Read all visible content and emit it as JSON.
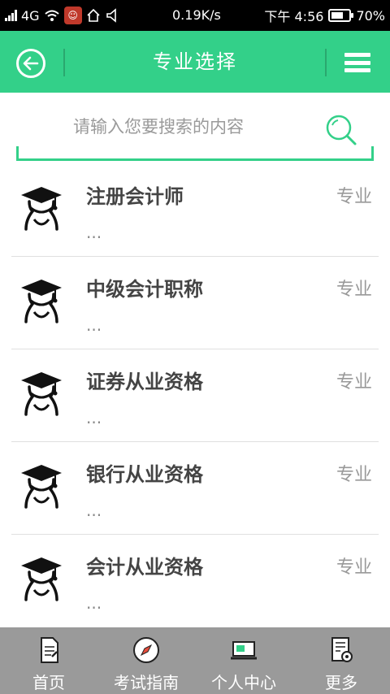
{
  "status_bar": {
    "network": "4G",
    "speed": "0.19K/s",
    "time": "下午 4:56",
    "battery": "70%",
    "battery_level": 0.7
  },
  "header": {
    "title": "专业选择"
  },
  "search": {
    "placeholder": "请输入您要搜索的内容"
  },
  "items": [
    {
      "title": "注册会计师",
      "sub": "...",
      "tag": "专业"
    },
    {
      "title": "中级会计职称",
      "sub": "...",
      "tag": "专业"
    },
    {
      "title": "证券从业资格",
      "sub": "...",
      "tag": "专业"
    },
    {
      "title": "银行从业资格",
      "sub": "...",
      "tag": "专业"
    },
    {
      "title": "会计从业资格",
      "sub": "...",
      "tag": "专业"
    }
  ],
  "bottom_nav": [
    {
      "label": "首页",
      "icon": "document-icon"
    },
    {
      "label": "考试指南",
      "icon": "compass-icon"
    },
    {
      "label": "个人中心",
      "icon": "laptop-icon"
    },
    {
      "label": "更多",
      "icon": "settings-list-icon"
    }
  ],
  "colors": {
    "accent": "#33d089",
    "nav_bg": "#9a9a9a"
  }
}
